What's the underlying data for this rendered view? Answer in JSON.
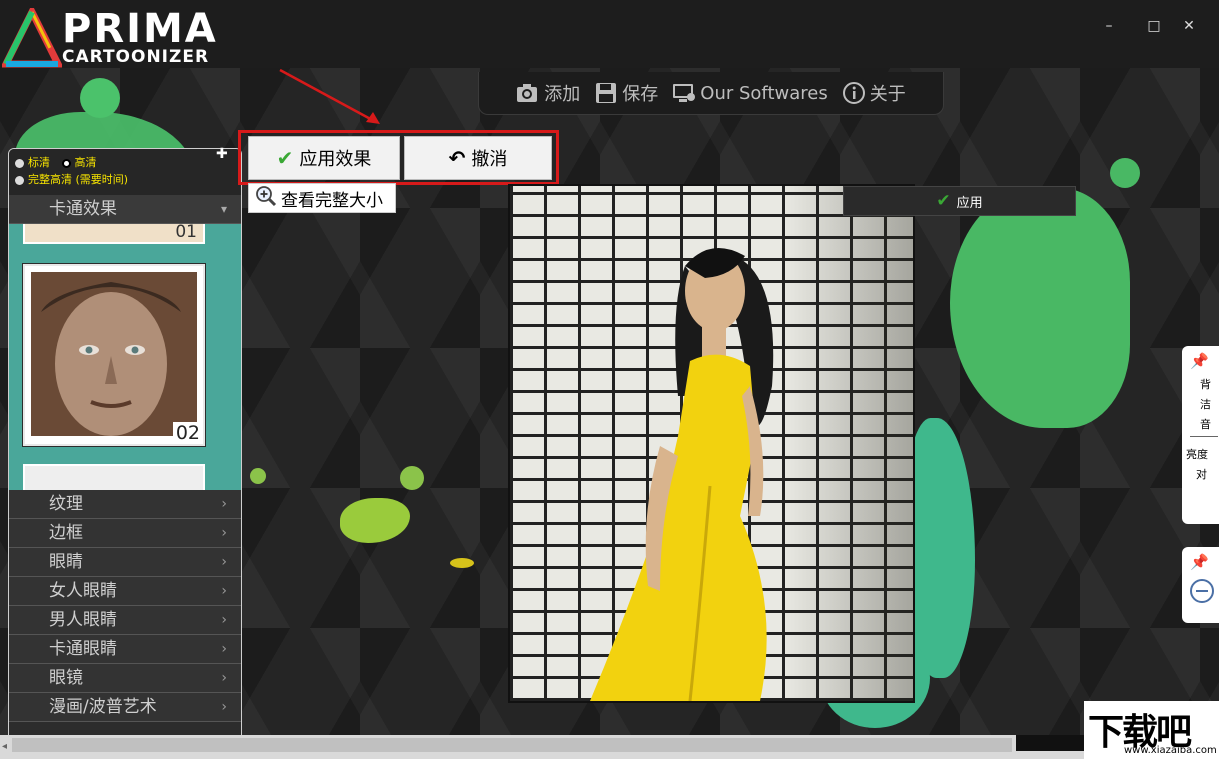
{
  "app": {
    "logo_top": "PRIMA",
    "logo_bottom": "CARTOONIZER",
    "window_controls": {
      "minimize": "–",
      "maximize": "□",
      "close": "✕"
    }
  },
  "toolbar": {
    "add_label": "添加",
    "save_label": "保存",
    "software_label": "Our Softwares",
    "about_label": "关于"
  },
  "quality": {
    "standard": "标清",
    "high": "高清",
    "full_hd": "完整高清 (需要时间)"
  },
  "effects": {
    "section_title": "卡通效果",
    "thumb_top_number": "01",
    "thumb_selected_number": "02"
  },
  "menu": {
    "items": [
      "纹理",
      "边框",
      "眼睛",
      "女人眼睛",
      "男人眼睛",
      "卡通眼睛",
      "眼镜",
      "漫画/波普艺术"
    ]
  },
  "actions": {
    "apply_effect": "应用效果",
    "undo": "撤消",
    "view_full": "查看完整大小",
    "apply_small": "应用"
  },
  "right_panel": {
    "labels": [
      "背",
      "洁",
      "音",
      "亮度",
      "对"
    ]
  },
  "watermark": {
    "big": "下载吧",
    "small": "www.xiazaiba.com"
  },
  "colors": {
    "accent_red": "#d71a1a",
    "panel_teal": "#4aa79a",
    "toolbar_text": "#bdbdbd",
    "quality_text": "#f5e200",
    "splash_green": "#4bc26b"
  }
}
